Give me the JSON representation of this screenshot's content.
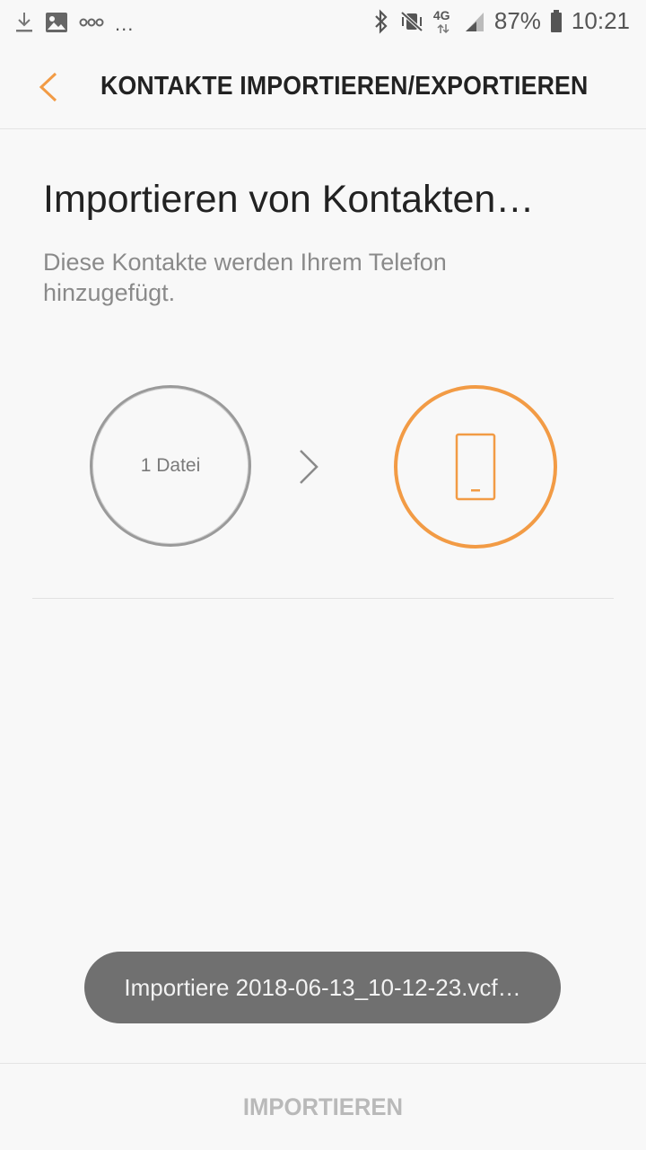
{
  "status_bar": {
    "left_icons": [
      "download-icon",
      "image-icon",
      "link-icon"
    ],
    "more_indicator": "...",
    "network_label": "4G",
    "battery_percent": "87%",
    "time": "10:21"
  },
  "app_bar": {
    "title": "KONTAKTE IMPORTIEREN/EXPORTIEREN",
    "accent_color": "#f29b45"
  },
  "content": {
    "heading": "Importieren von Kontakten…",
    "description": "Diese Kontakte werden Ihrem Telefon hinzugefügt.",
    "source_label": "1 Datei",
    "target_icon": "phone-icon"
  },
  "toast": {
    "message": "Importiere 2018-06-13_10-12-23.vcf…"
  },
  "footer": {
    "import_button_label": "IMPORTIEREN"
  }
}
